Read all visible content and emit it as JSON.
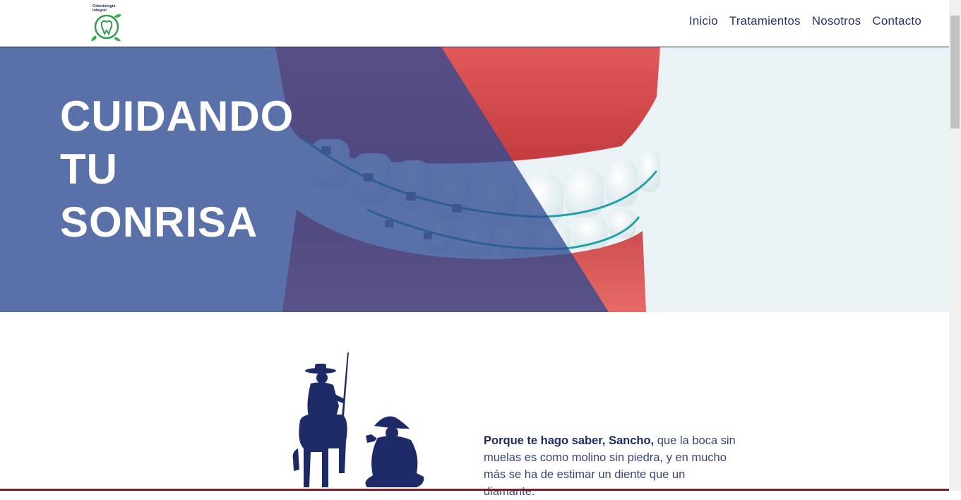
{
  "logo": {
    "line1": "Odontología",
    "line2": "Integral",
    "icon": "tooth-leaf-icon"
  },
  "nav": {
    "items": [
      {
        "label": "Inicio"
      },
      {
        "label": "Tratamientos"
      },
      {
        "label": "Nosotros"
      },
      {
        "label": "Contacto"
      }
    ]
  },
  "hero": {
    "line1": "CUIDANDO",
    "line2": "TU",
    "line3": "SONRISA"
  },
  "quote": {
    "lead": "Porque te hago saber, Sancho,",
    "body": " que la boca sin muelas es como molino sin piedra, y en mucho más se ha de estimar un diente que un diamante."
  },
  "colors": {
    "brand_navy": "#1d2a66",
    "overlay_blue": "#3b5998",
    "overlay_red": "#e8504f",
    "logo_green": "#2e9e4f"
  }
}
